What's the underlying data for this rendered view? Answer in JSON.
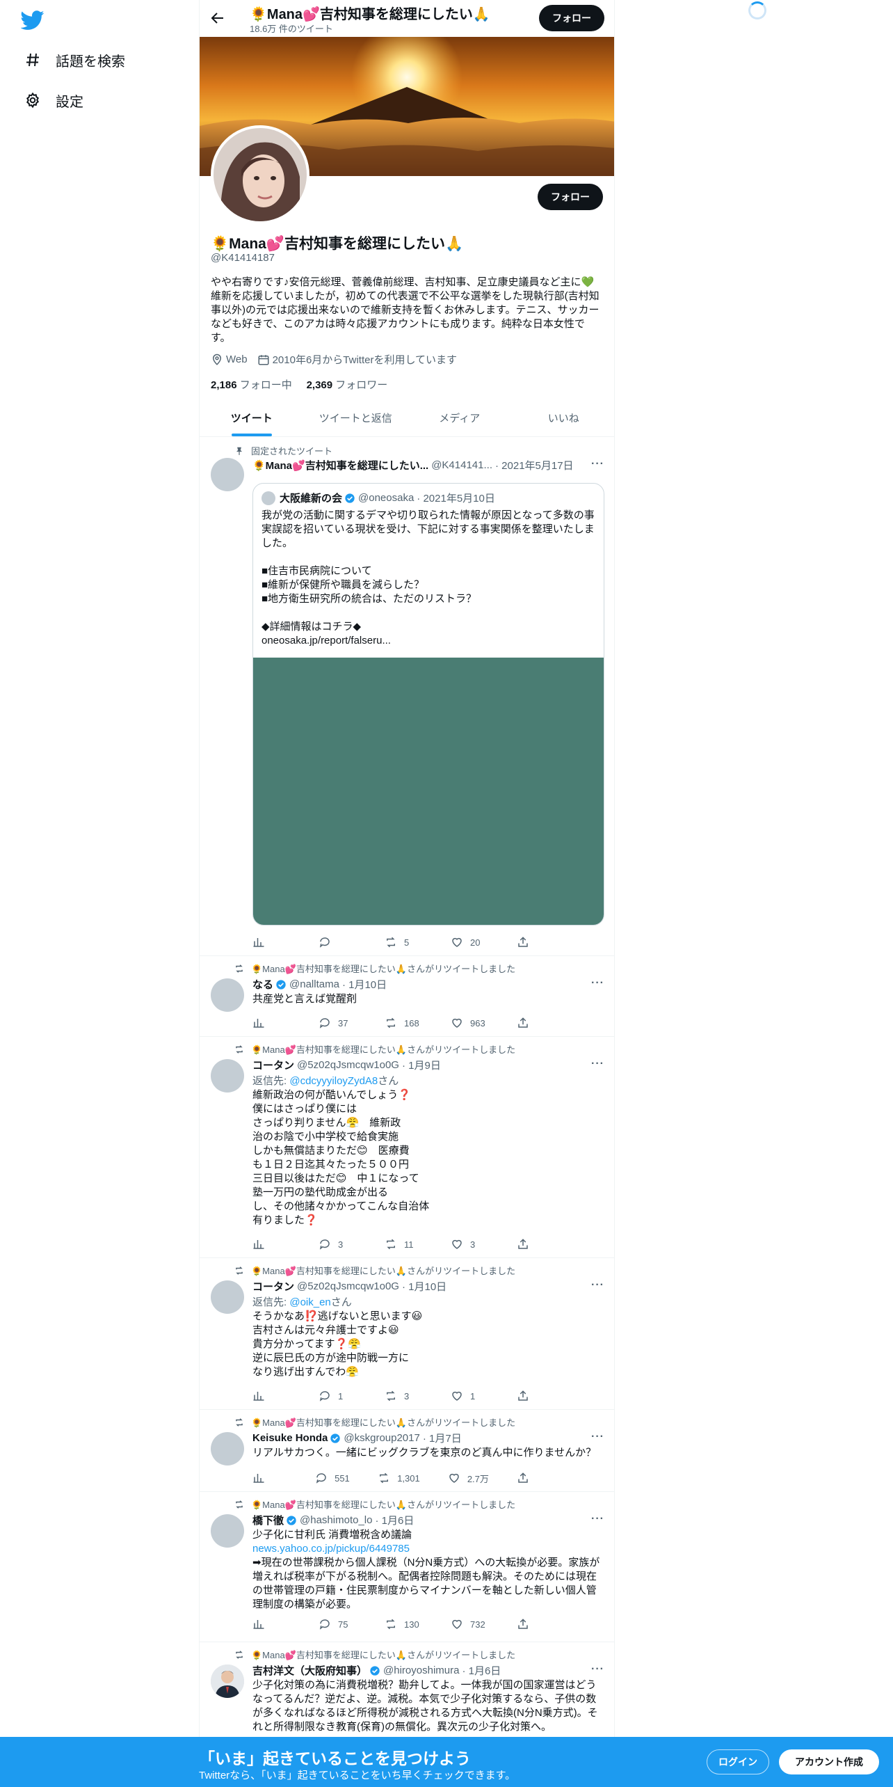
{
  "nav": {
    "explore": "話題を検索",
    "settings": "設定"
  },
  "topbar": {
    "name": "🌻Mana💕吉村知事を総理にしたい🙏",
    "tweet_count": "18.6万 件のツイート",
    "follow": "フォロー"
  },
  "profile": {
    "follow": "フォロー",
    "name": "🌻Mana💕吉村知事を総理にしたい🙏",
    "handle": "@K41414187",
    "bio": "やや右寄りです♪安倍元総理、菅義偉前総理、吉村知事、足立康史議員など主に💚維新を応援していましたが，初めての代表選で不公平な選挙をした現執行部(吉村知事以外)の元では応援出来ないので維新支持を暫くお休みします。テニス、サッカーなども好きで、このアカは時々応援アカウントにも成ります。純粋な日本女性です。",
    "location": "Web",
    "joined": "2010年6月からTwitterを利用しています",
    "following_count": "2,186",
    "following_label": "フォロー中",
    "followers_count": "2,369",
    "followers_label": "フォロワー"
  },
  "tabs": [
    "ツイート",
    "ツイートと返信",
    "メディア",
    "いいね"
  ],
  "pinned": {
    "context": "固定されたツイート",
    "name": "🌻Mana💕吉村知事を総理にしたい...",
    "handle": "@K414141...",
    "date": "· 2021年5月17日",
    "quote": {
      "name": "大阪維新の会",
      "handle": "@oneosaka",
      "date": "· 2021年5月10日",
      "body": "我が党の活動に関するデマや切り取られた情報が原因となって多数の事実誤認を招いている現状を受け、下記に対する事実関係を整理いたしました。\n\n■住吉市民病院について\n■維新が保健所や職員を減らした？\n■地方衛生研究所の統合は、ただのリストラ？\n\n◆詳細情報はコチラ◆\noneosaka.jp/report/falseru..."
    },
    "replies": "",
    "retweets": "5",
    "likes": "20"
  },
  "retweet_context": "🌻Mana💕吉村知事を総理にしたい🙏さんがリツイートしました",
  "tweets": [
    {
      "name": "なる",
      "handle": "@nalltama",
      "date": "· 1月10日",
      "body": "共産党と言えば覚醒剤",
      "replies": "37",
      "retweets": "168",
      "likes": "963"
    },
    {
      "name": "コータン",
      "handle": "@5z02qJsmcqw1o0G",
      "date": "· 1月9日",
      "reply_prefix": "返信先: ",
      "reply_to": "@cdcyyyiloyZydA8",
      "reply_suffix": "さん",
      "body": "維新政治の何が酷いんでしょう❓\n僕にはさっぱり僕には\nさっぱり判りません😤　維新政\n治のお陰で小中学校で給食実施\nしかも無償詰まりただ😊　医療費\nも１日２日迄其々たった５００円\n三日目以後はただ😊　中１になって\n塾一万円の塾代助成金が出る\nし、その他諸々かかってこんな自治体\n有りました❓",
      "replies": "3",
      "retweets": "11",
      "likes": "3"
    },
    {
      "name": "コータン",
      "handle": "@5z02qJsmcqw1o0G",
      "date": "· 1月10日",
      "reply_prefix": "返信先: ",
      "reply_to": "@oik_en",
      "reply_suffix": "さん",
      "body": "そうかなあ⁉️逃げないと思います😃\n吉村さんは元々弁護士ですよ😃\n貴方分かってます❓😤\n逆に辰巳氏の方が途中防戦一方に\nなり逃げ出すんでわ😤",
      "replies": "1",
      "retweets": "3",
      "likes": "1"
    },
    {
      "name": "Keisuke Honda",
      "handle": "@kskgroup2017",
      "date": "· 1月7日",
      "body": "リアルサカつく。一緒にビッグクラブを東京のど真ん中に作りませんか？",
      "replies": "551",
      "retweets": "1,301",
      "likes": "2.7万"
    },
    {
      "name": "橋下徹",
      "handle": "@hashimoto_lo",
      "date": "· 1月6日",
      "body": "少子化に甘利氏 消費増税含め議論",
      "link": "news.yahoo.co.jp/pickup/6449785",
      "body2": "➡現在の世帯課税から個人課税（N分N乗方式）への大転換が必要。家族が増えれば税率が下がる税制へ。配偶者控除問題も解決。そのためには現在の世帯管理の戸籍・住民票制度からマイナンバーを軸とした新しい個人管理制度の構築が必要。",
      "replies": "75",
      "retweets": "130",
      "likes": "732"
    },
    {
      "name": "吉村洋文（大阪府知事）",
      "handle": "@hiroyoshimura",
      "date": "· 1月6日",
      "body": "少子化対策の為に消費税増税？勘弁してよ。一体我が国の国家運営はどうなってるんだ？逆だよ、逆。減税。本気で少子化対策するなら、子供の数が多くなればなるほど所得税が減税される方式へ大転換(N分N乗方式)。それと所得制限なき教育(保育)の無償化。異次元の少子化対策へ。"
    }
  ],
  "bottombar": {
    "title": "「いま」起きていることを見つけよう",
    "subtitle": "Twitterなら、「いま」起きていることをいち早くチェックできます。",
    "login": "ログイン",
    "signup": "アカウント作成"
  },
  "colors": {
    "accent": "#1d9bf0",
    "text": "#0f1419",
    "secondary": "#536471",
    "media_placeholder": "#4a7d73"
  }
}
